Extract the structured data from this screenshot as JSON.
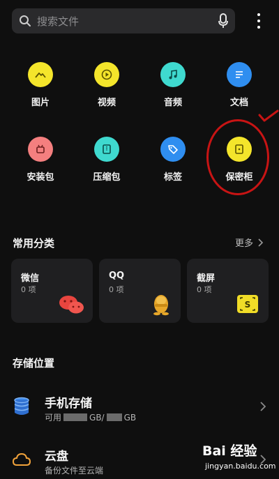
{
  "search": {
    "placeholder": "搜索文件"
  },
  "categories": [
    {
      "label": "图片",
      "icon": "image-icon",
      "color": "#f4e52b"
    },
    {
      "label": "视频",
      "icon": "play-icon",
      "color": "#f4e52b"
    },
    {
      "label": "音频",
      "icon": "music-note-icon",
      "color": "#3fd9cf"
    },
    {
      "label": "文档",
      "icon": "document-icon",
      "color": "#2f8ef0"
    },
    {
      "label": "安装包",
      "icon": "android-package-icon",
      "color": "#f47f7f"
    },
    {
      "label": "压缩包",
      "icon": "archive-icon",
      "color": "#3fd9cf"
    },
    {
      "label": "标签",
      "icon": "tag-icon",
      "color": "#2f8ef0"
    },
    {
      "label": "保密柜",
      "icon": "safe-icon",
      "color": "#f4e52b"
    }
  ],
  "common": {
    "title": "常用分类",
    "more": "更多",
    "cards": [
      {
        "title": "微信",
        "count": "0 项",
        "icon": "wechat-icon"
      },
      {
        "title": "QQ",
        "count": "0 项",
        "icon": "qq-penguin-icon"
      },
      {
        "title": "截屏",
        "count": "0 项",
        "icon": "screenshot-icon"
      }
    ]
  },
  "storage": {
    "title": "存储位置",
    "items": [
      {
        "name": "手机存储",
        "sub_prefix": "可用",
        "unit1": "GB/",
        "unit2": "GB",
        "icon": "database-icon"
      },
      {
        "name": "云盘",
        "sub": "备份文件至云端",
        "icon": "cloud-icon"
      }
    ]
  },
  "watermark": {
    "brand": "Bai 经验",
    "url": "jingyan.baidu.com"
  },
  "colors": {
    "background": "#0f0f0f",
    "annotation": "#c81414",
    "card": "#1f1f21"
  }
}
